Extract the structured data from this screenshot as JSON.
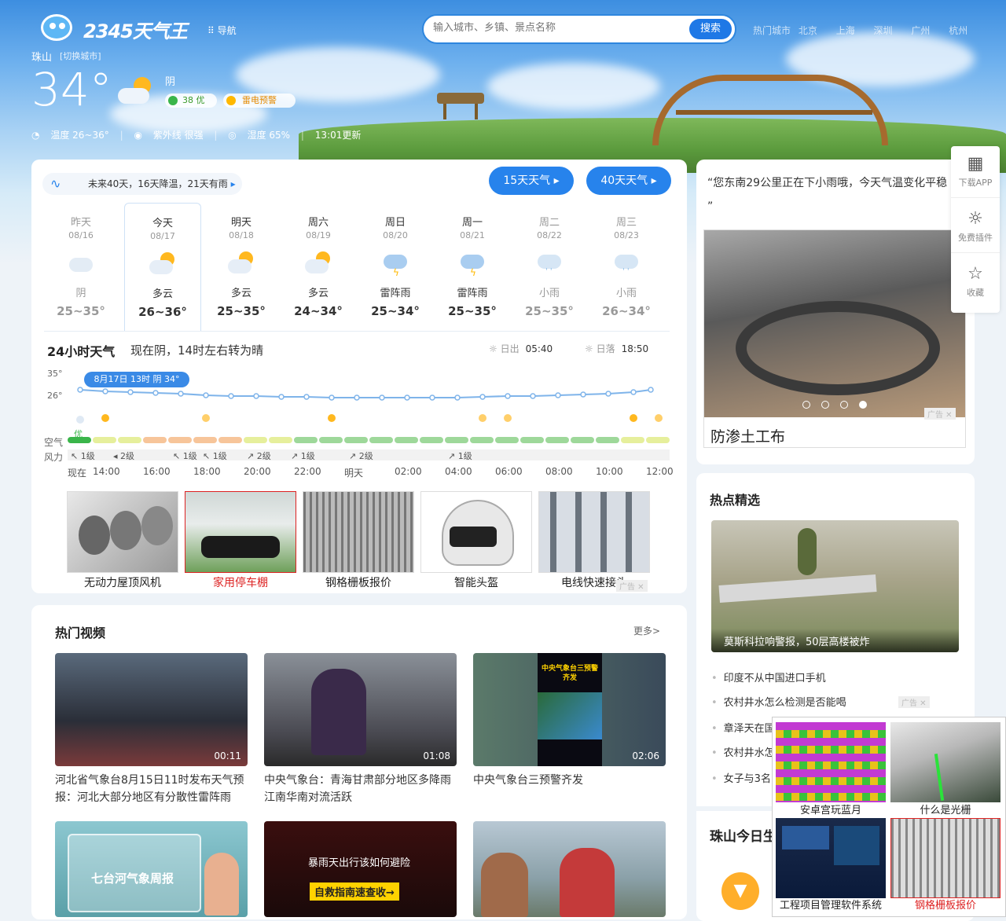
{
  "header": {
    "logo": "2345天气王",
    "nav": "导航",
    "search_placeholder": "输入城市、乡镇、景点名称",
    "search_button": "搜索",
    "hot_cities_label": "热门城市",
    "hot_cities": [
      "北京",
      "上海",
      "深圳",
      "广州",
      "杭州"
    ]
  },
  "current": {
    "city": "珠山",
    "switch": "[切换城市]",
    "temp": "34°",
    "condition": "阴",
    "aqi_value": "38",
    "aqi_level": "优",
    "alert": "雷电预警",
    "temp_range": "温度 26~36°",
    "uv": "紫外线 很强",
    "humidity": "湿度 65%",
    "update_time": "13:01更新"
  },
  "forecast": {
    "note": "未来40天，16天降温，21天有雨",
    "btn15": "15天天气",
    "btn40": "40天天气",
    "days": [
      {
        "name": "昨天",
        "date": "08/16",
        "cond": "阴",
        "range": "25~35°",
        "icon": "cloudy-icon"
      },
      {
        "name": "今天",
        "date": "08/17",
        "cond": "多云",
        "range": "26~36°",
        "icon": "partly-cloudy-icon"
      },
      {
        "name": "明天",
        "date": "08/18",
        "cond": "多云",
        "range": "25~35°",
        "icon": "partly-cloudy-icon"
      },
      {
        "name": "周六",
        "date": "08/19",
        "cond": "多云",
        "range": "24~34°",
        "icon": "partly-cloudy-icon"
      },
      {
        "name": "周日",
        "date": "08/20",
        "cond": "雷阵雨",
        "range": "25~34°",
        "icon": "thunderstorm-icon"
      },
      {
        "name": "周一",
        "date": "08/21",
        "cond": "雷阵雨",
        "range": "25~35°",
        "icon": "thunderstorm-icon"
      },
      {
        "name": "周二",
        "date": "08/22",
        "cond": "小雨",
        "range": "25~35°",
        "icon": "light-rain-icon"
      },
      {
        "name": "周三",
        "date": "08/23",
        "cond": "小雨",
        "range": "26~34°",
        "icon": "light-rain-icon"
      }
    ]
  },
  "hourly": {
    "title": "24小时天气",
    "desc": "现在阴，14时左右转为晴",
    "sunrise_label": "日出",
    "sunrise": "05:40",
    "sunset_label": "日落",
    "sunset": "18:50",
    "y_high": "35°",
    "y_low": "26°",
    "tooltip": "8月17日 13时 阴 34°",
    "aqi_label": "空气",
    "aqi_level": "优",
    "wind_label": "风力",
    "winds": [
      "1级",
      "2级",
      "1级",
      "1级",
      "2级",
      "1级",
      "2级",
      "1级"
    ],
    "times": [
      "现在",
      "14:00",
      "16:00",
      "18:00",
      "20:00",
      "22:00",
      "明天",
      "02:00",
      "04:00",
      "06:00",
      "08:00",
      "10:00",
      "12:00"
    ]
  },
  "ads": {
    "items": [
      "无动力屋顶风机",
      "家用停车棚",
      "钢格栅板报价",
      "智能头盔",
      "电线快速接头"
    ],
    "tag": "广告"
  },
  "videos": {
    "title": "热门视频",
    "more": "更多>",
    "items": [
      {
        "caption": "河北省气象台8月15日11时发布天气预报：河北大部分地区有分散性雷阵雨",
        "duration": "00:11"
      },
      {
        "caption": "中央气象台：青海甘肃部分地区多降雨江南华南对流活跃",
        "duration": "01:08"
      },
      {
        "caption": "中央气象台三预警齐发",
        "duration": "02:06",
        "overlay": "中央气象台三预警齐发"
      }
    ],
    "row2": [
      {
        "overlay": "七台河气象周报"
      },
      {
        "overlay_top": "暴雨天出行该如何避险",
        "overlay_bottom": "自救指南速查收→"
      },
      {
        "overlay": ""
      }
    ]
  },
  "right": {
    "quote": "“您东南29公里正在下小雨哦，今天气温变化平稳 ”",
    "banner_caption": "防渗土工布",
    "ad_tag": "广告",
    "hot_title": "热点精选",
    "hot_image_caption": "莫斯科拉响警报，50层高楼被炸",
    "news": [
      "印度不从中国进口手机",
      "农村井水怎么检测是否能喝",
      "章泽天在国",
      "农村井水怎",
      "女子与3名"
    ],
    "today_title": "珠山今日生"
  },
  "tools": {
    "app": "下载APP",
    "plugin": "免费插件",
    "fav": "收藏"
  },
  "popup": {
    "tiles": [
      "安卓宫玩蓝月",
      "什么是光栅",
      "工程项目管理软件系统",
      "钢格栅板报价"
    ],
    "tag": "广告"
  },
  "colors": {
    "accent": "#2783ec",
    "aqi_good": "#3ab54a",
    "alert": "#ffb800"
  }
}
